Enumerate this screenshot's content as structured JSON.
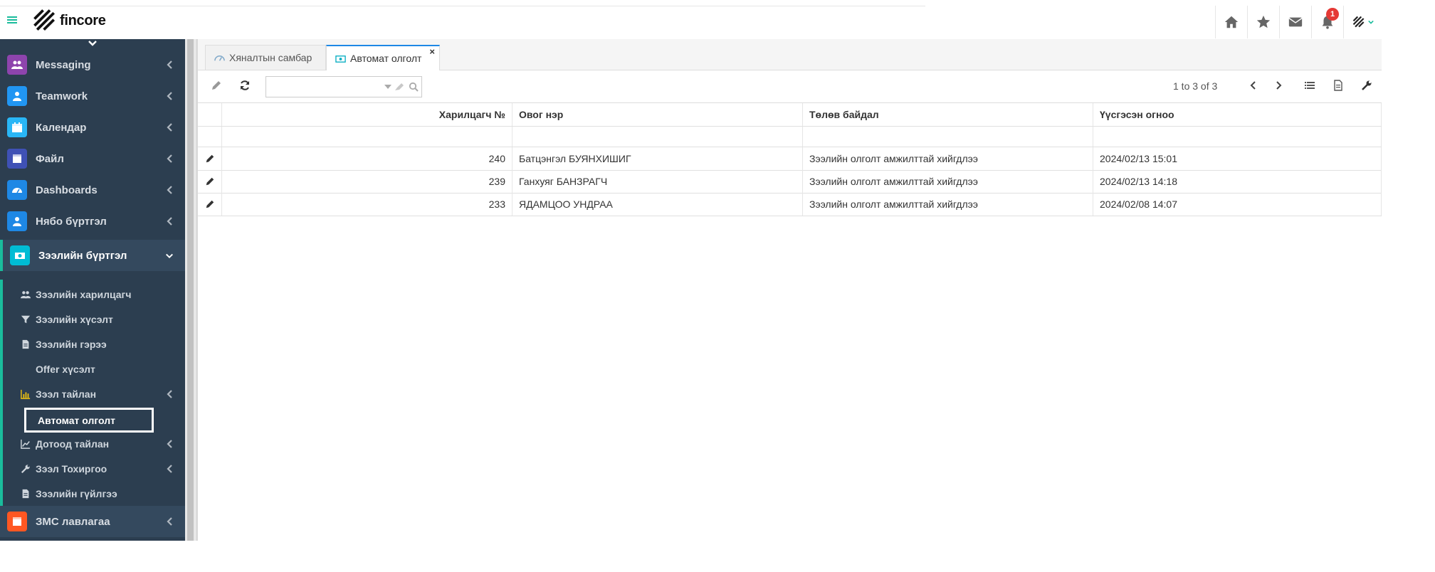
{
  "app": {
    "logo_text_main": "fin",
    "logo_text_accent": "core"
  },
  "header": {
    "notification_count": "1",
    "icons": [
      "home-icon",
      "star-icon",
      "envelope-icon",
      "bell-icon",
      "brand-menu-icon"
    ]
  },
  "sidebar": {
    "items": [
      {
        "label": "Messaging",
        "icon": "users-icon",
        "color": "#8e44ad"
      },
      {
        "label": "Teamwork",
        "icon": "user-icon",
        "color": "#2196f3"
      },
      {
        "label": "Календар",
        "icon": "calendar-icon",
        "color": "#29b6f6"
      },
      {
        "label": "Файл",
        "icon": "file-icon",
        "color": "#3f51b5"
      },
      {
        "label": "Dashboards",
        "icon": "dashboard-icon",
        "color": "#1e88e5"
      },
      {
        "label": "Нябо бүртгэл",
        "icon": "user-icon",
        "color": "#1e88e5"
      },
      {
        "label": "Зээлийн бүртгэл",
        "icon": "money-icon",
        "color": "#00bcd4"
      }
    ],
    "submenu": [
      {
        "label": "Зээлийн харилцагч",
        "icon": "users-icon"
      },
      {
        "label": "Зээлийн хүсэлт",
        "icon": "filter-icon"
      },
      {
        "label": "Зээлийн гэрээ",
        "icon": "document-icon"
      },
      {
        "label": "Offer хүсэлт",
        "icon": ""
      },
      {
        "label": "Зээл тайлан",
        "icon": "bar-chart-icon"
      },
      {
        "label": "Автомат олголт",
        "icon": ""
      },
      {
        "label": "Дотоод тайлан",
        "icon": "line-chart-icon"
      },
      {
        "label": "Зээл Тохиргоо",
        "icon": "wrench-icon"
      },
      {
        "label": "Зээлийн гүйлгээ",
        "icon": "document-icon"
      }
    ],
    "bottom_item": {
      "label": "ЗМС лавлагаа",
      "icon": "file-icon",
      "color": "#ff5722"
    }
  },
  "tabs": [
    {
      "label": "Хяналтын самбар",
      "icon": "dashboard-icon"
    },
    {
      "label": "Автомат олголт",
      "icon": "money-icon",
      "close": "×"
    }
  ],
  "toolbar": {
    "search_value": "",
    "search_placeholder": "",
    "pager_text": "1 to 3 of 3"
  },
  "table": {
    "columns": [
      "Харилцагч №",
      "Овог нэр",
      "Төлөв байдал",
      "Үүсгэсэн огноо"
    ],
    "rows": [
      {
        "id": "240",
        "name": "Батцэнгэл БУЯНХИШИГ",
        "status": "Зээлийн олголт амжилттай хийгдлээ",
        "created": "2024/02/13 15:01"
      },
      {
        "id": "239",
        "name": "Ганхуяг БАНЗРАГЧ",
        "status": "Зээлийн олголт амжилттай хийгдлээ",
        "created": "2024/02/13 14:18"
      },
      {
        "id": "233",
        "name": "ЯДАМЦОО УНДРАА",
        "status": "Зээлийн олголт амжилттай хийгдлээ",
        "created": "2024/02/08 14:07"
      }
    ]
  }
}
